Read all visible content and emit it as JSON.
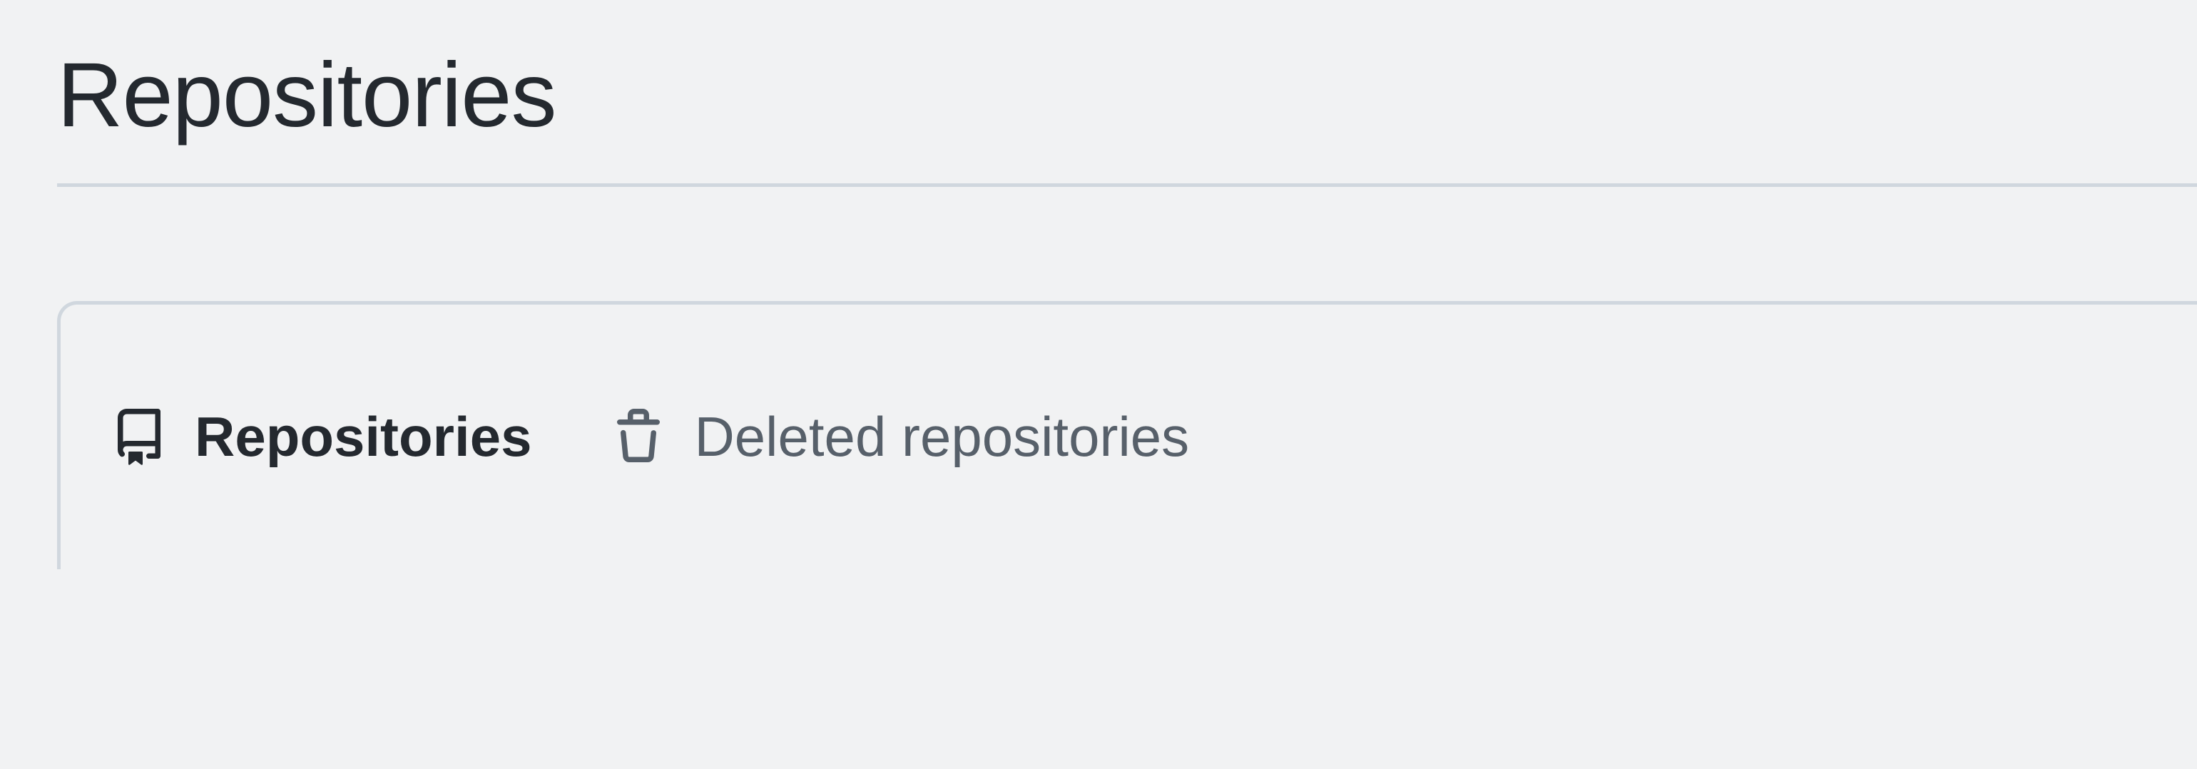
{
  "page": {
    "title": "Repositories"
  },
  "tabs": {
    "repositories": {
      "label": "Repositories"
    },
    "deleted": {
      "label": "Deleted repositories"
    }
  }
}
